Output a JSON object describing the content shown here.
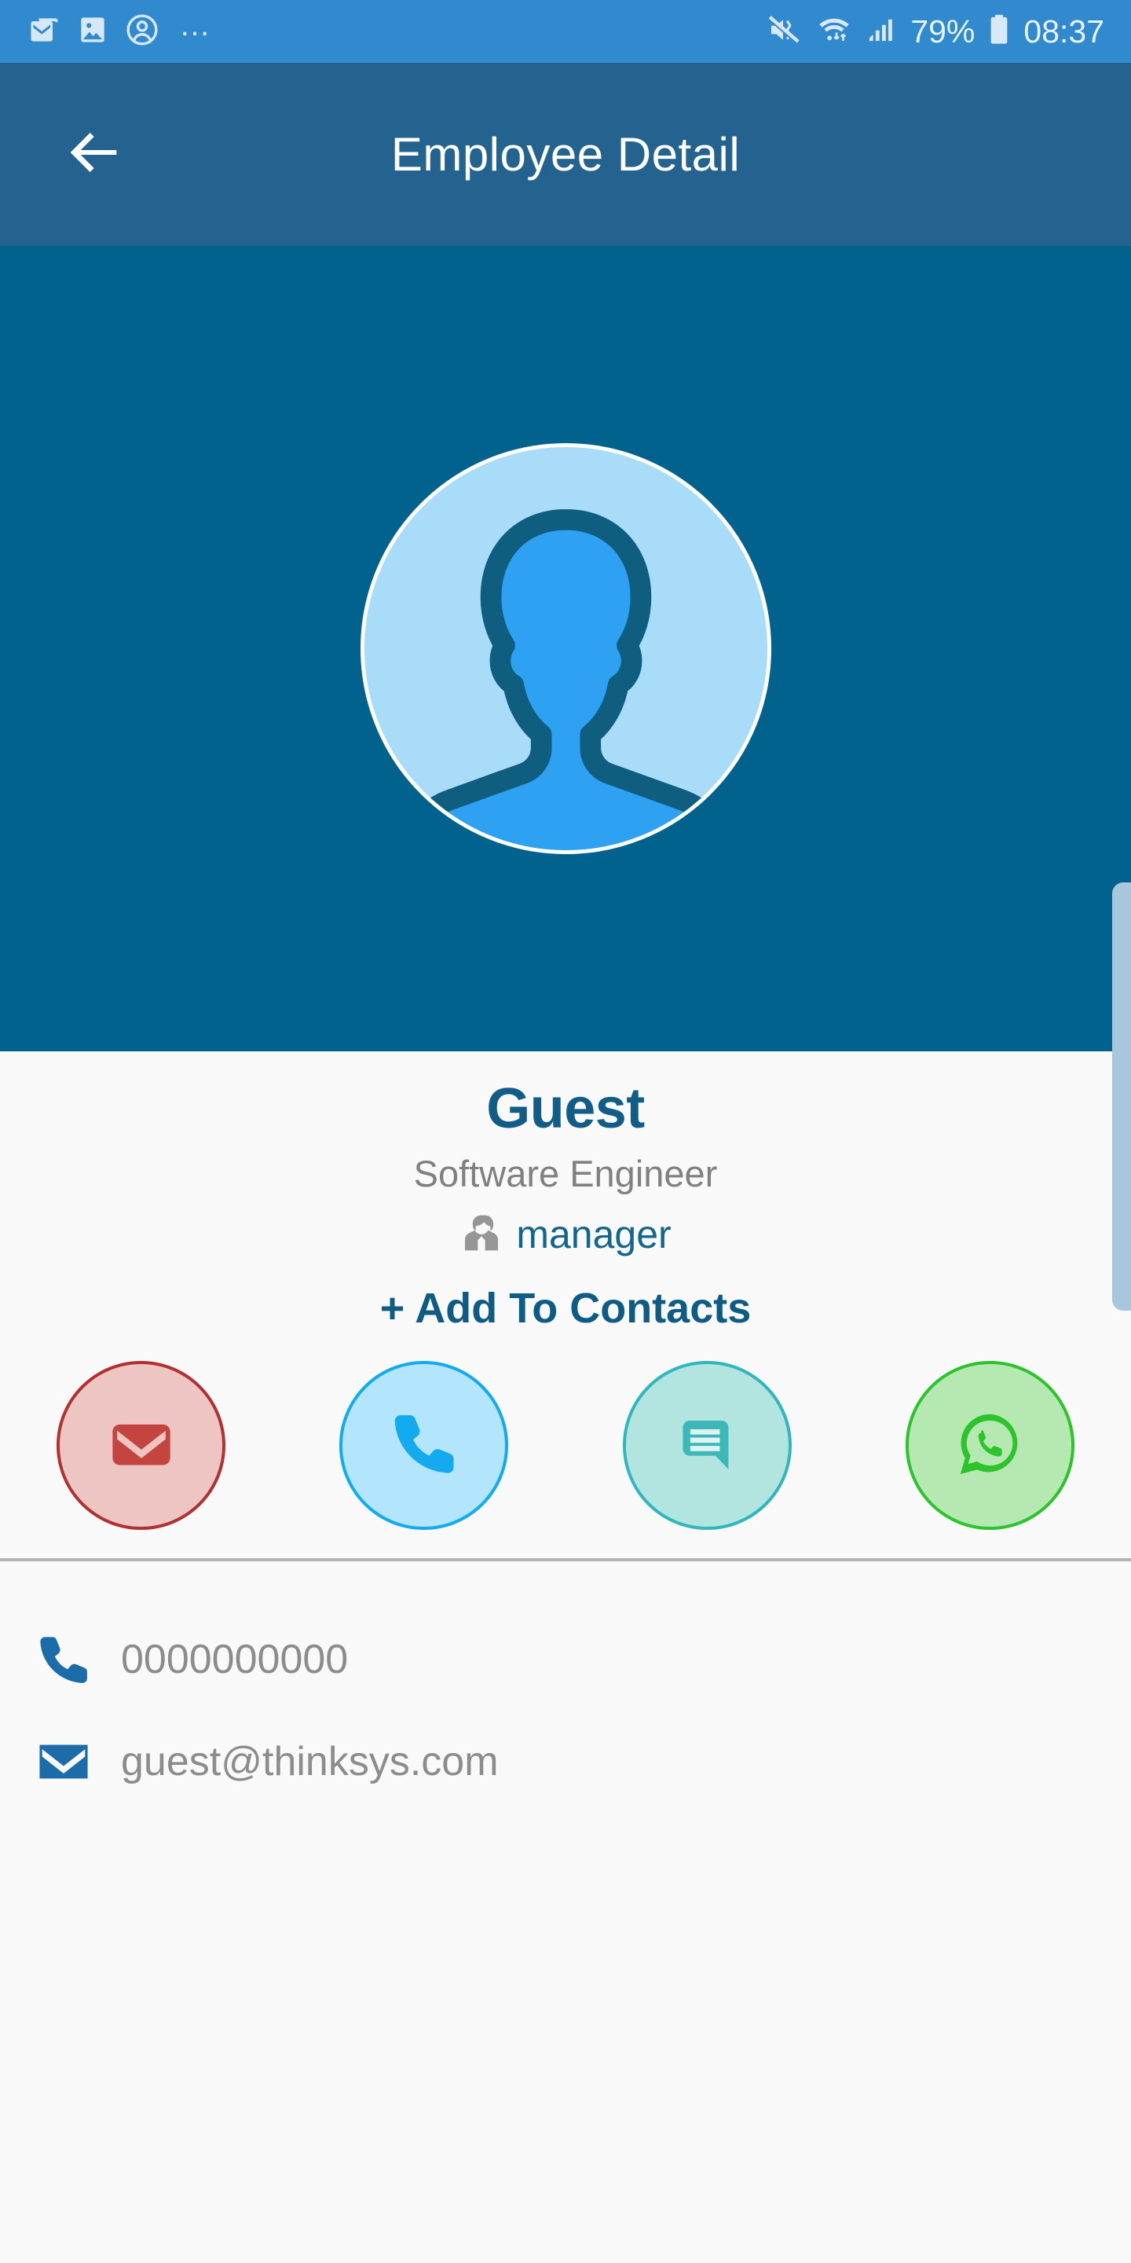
{
  "status_bar": {
    "left_icons": [
      "mail-icon",
      "gallery-icon",
      "account-circle-icon",
      "more-icon"
    ],
    "dots": "…",
    "right_icons": [
      "mute-vibrate-icon",
      "wifi-icon",
      "signal-icon",
      "battery-icon"
    ],
    "battery_percent": "79%",
    "time": "08:37",
    "background": "#3189CE"
  },
  "app_bar": {
    "title": "Employee Detail",
    "back_icon": "arrow-back-icon",
    "background": "#24638F"
  },
  "banner": {
    "avatar_icon": "person-placeholder-icon",
    "background": "#01628E",
    "scrollbar_visible": true
  },
  "profile": {
    "name": "Guest",
    "name_color": "#115D87",
    "designation": "Software Engineer",
    "designation_color": "#808080",
    "manager_icon": "manager-person-icon",
    "manager_label": "manager",
    "manager_color": "#14658D",
    "add_to_contacts_label": "+ Add To Contacts",
    "add_to_contacts_color": "#0E5B83"
  },
  "actions": [
    {
      "name": "email-action-button",
      "icon": "envelope-icon",
      "fill": "#EDC6C4",
      "border": "#B03130",
      "glyph": "#C44540"
    },
    {
      "name": "call-action-button",
      "icon": "phone-icon",
      "fill": "#B3E5FC",
      "border": "#13AAF0",
      "glyph": "#13AAF0"
    },
    {
      "name": "sms-action-button",
      "icon": "message-icon",
      "fill": "#B2E4E0",
      "border": "#30B6BC",
      "glyph": "#3EB7B8"
    },
    {
      "name": "whatsapp-action-button",
      "icon": "whatsapp-icon",
      "fill": "#B6E9B2",
      "border": "#2CC32C",
      "glyph": "#2CC32C"
    }
  ],
  "contact_details": [
    {
      "icon": "phone-icon",
      "value": "0000000000"
    },
    {
      "icon": "email-icon",
      "value": "guest@thinksys.com"
    }
  ],
  "colors": {
    "page_background": "#F9F9F9",
    "divider": "#B3B3B3",
    "contact_icon": "#1B6CA8",
    "contact_text": "#8C8C8C"
  }
}
